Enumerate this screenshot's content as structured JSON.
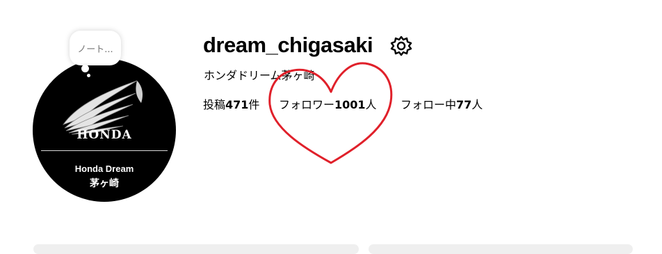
{
  "note": {
    "text": "ノート..."
  },
  "avatar": {
    "brand": "HONDA",
    "dealer_name": "Honda Dream",
    "dealer_location": "茅ヶ崎"
  },
  "profile": {
    "username": "dream_chigasaki",
    "full_name": "ホンダドリーム茅ヶ崎",
    "settings_icon": "gear-icon"
  },
  "stats": {
    "posts_label": "投稿",
    "posts_count": "471",
    "posts_unit": "件",
    "followers_label": "フォロワー",
    "followers_count": "1001",
    "followers_unit": "人",
    "following_label": "フォロー中",
    "following_count": "77",
    "following_unit": "人"
  },
  "annotation": {
    "shape": "heart-icon",
    "color": "#e0202a"
  }
}
